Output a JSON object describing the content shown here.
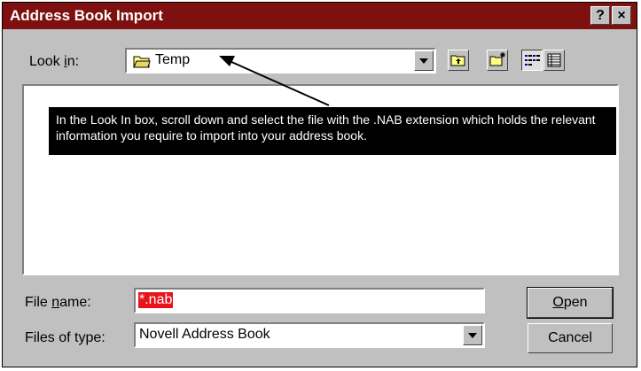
{
  "window": {
    "title": "Address Book Import"
  },
  "title_buttons": {
    "help": "?",
    "close": "×"
  },
  "look_in": {
    "label_pre": "Look ",
    "label_key": "i",
    "label_post": "n:",
    "value": "Temp"
  },
  "callout": {
    "text": "In the Look In box, scroll down and select the file with the .NAB extension which holds the relevant information you require to import into your address book."
  },
  "file_name": {
    "label_pre": "File ",
    "label_key": "n",
    "label_post": "ame:",
    "value": "*.nab"
  },
  "files_of_type": {
    "label": "Files of type:",
    "value": "Novell Address Book"
  },
  "buttons": {
    "open_key": "O",
    "open_rest": "pen",
    "cancel": "Cancel"
  },
  "colors": {
    "title_bar": "#7f1010",
    "dialog_face": "#c0c0c0",
    "selection": "#e8141c"
  },
  "icons": [
    "help-icon",
    "close-icon",
    "folder-icon",
    "up-folder-icon",
    "new-folder-icon",
    "list-view-icon",
    "details-view-icon",
    "dropdown-arrow-icon"
  ]
}
